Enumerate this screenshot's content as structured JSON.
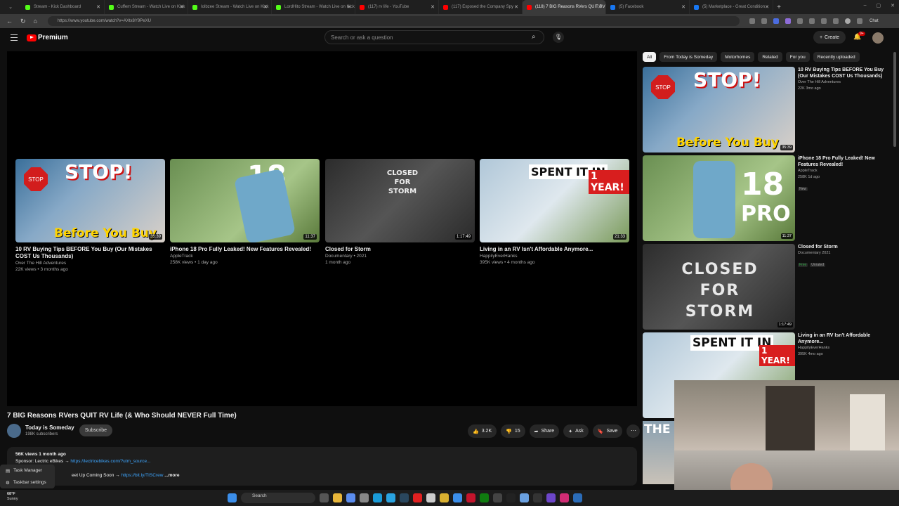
{
  "browser": {
    "tabs": [
      {
        "title": "Stream - Kick Dashboard",
        "color": "#53fc18"
      },
      {
        "title": "Cuffem Stream - Watch Live on Kick",
        "color": "#53fc18"
      },
      {
        "title": "Iolbzee Stream - Watch Live on Kick",
        "color": "#53fc18"
      },
      {
        "title": "LordHito Stream - Watch Live on Kick",
        "color": "#53fc18"
      },
      {
        "title": "(117) rv life - YouTube",
        "color": "#ff0000"
      },
      {
        "title": "(117) Exposed the Company Spy",
        "color": "#ff0000"
      },
      {
        "title": "(118) 7 BIG Reasons RVers QUIT RV",
        "color": "#ff0000",
        "active": true
      },
      {
        "title": "(5) Facebook",
        "color": "#1877f2"
      },
      {
        "title": "(5) Marketplace - Great Condition",
        "color": "#1877f2"
      }
    ],
    "url": "https://www.youtube.com/watch?v=AXtx8Y9PeXU",
    "chat_label": "Chat"
  },
  "header": {
    "logo_text": "Premium",
    "search_placeholder": "Search or ask a question",
    "create_label": "Create",
    "notif_badge": "9+"
  },
  "player": {
    "end_cards": [
      {
        "title": "10 RV Buying Tips BEFORE You Buy (Our Mistakes COST Us Thousands)",
        "channel": "Over The Hill Adventures",
        "stats": "22K views • 3 months ago",
        "duration": "35:39",
        "overlay_top": "STOP!",
        "overlay_bottom": "Before You Buy",
        "stop_text": "STOP"
      },
      {
        "title": "iPhone 18 Pro Fully Leaked! New Features Revealed!",
        "channel": "AppleTrack",
        "stats": "258K views • 1 day ago",
        "duration": "11:37",
        "overlay_top": "18"
      },
      {
        "title": "Closed for Storm",
        "channel": "Documentary • 2021",
        "stats": "1 month ago",
        "duration": "1:17:49",
        "overlay_top": "CLOSED FOR STORM"
      },
      {
        "title": "Living in an RV Isn't Affordable Anymore...",
        "channel": "HappilyEverHanks",
        "stats": "395K views • 4 months ago",
        "duration": "21:33",
        "overlay_top": "SPENT IT IN",
        "overlay_bottom": "1 YEAR!"
      }
    ]
  },
  "video": {
    "title": "7 BIG Reasons RVers QUIT RV Life (& Who Should NEVER Full Time)",
    "channel": "Today is Someday",
    "subscribers": "198K subscribers",
    "subscribe_label": "Subscribe",
    "likes": "3.2K",
    "dislikes": "15",
    "share_label": "Share",
    "ask_label": "Ask",
    "save_label": "Save",
    "description": {
      "stats": "56K views  1 month ago",
      "line1_prefix": "Sponsor: Lectric eBikes → ",
      "line1_link": "https://lectricebikes.com/?utm_source...",
      "line2_prefix": "eet Up Coming Soon → ",
      "line2_link": "https://bit.ly/TISCrew",
      "more_label": "...more"
    }
  },
  "context_menu": {
    "items": [
      "Task Manager",
      "Taskbar settings"
    ]
  },
  "sidebar": {
    "chips": [
      "All",
      "From Today is Someday",
      "Motorhomes",
      "Related",
      "For you",
      "Recently uploaded"
    ],
    "recommendations": [
      {
        "title": "10 RV Buying Tips BEFORE You Buy (Our Mistakes COST Us Thousands)",
        "channel": "Over The Hill Adventures",
        "stats": "22K  3mo ago",
        "duration": "35:39"
      },
      {
        "title": "iPhone 18 Pro Fully Leaked! New Features Revealed!",
        "channel": "AppleTrack",
        "stats": "258K  1d ago",
        "duration": "11:37",
        "tags": [
          "New"
        ],
        "thumb_text": "18",
        "thumb_text2": "PRO"
      },
      {
        "title": "Closed for Storm",
        "channel": "Documentary 2021",
        "stats": "",
        "duration": "1:17:49",
        "tags": [
          "Free",
          "Unrated"
        ],
        "thumb_text": "CLOSED FOR STORM"
      },
      {
        "title": "Living in an RV Isn't Affordable Anymore...",
        "channel": "HappilyEverHanks",
        "stats": "395K  4mo ago",
        "duration": "",
        "thumb_text": "SPENT IT IN",
        "thumb_text2": "1 YEAR!"
      }
    ],
    "partial_thumb_text": "THE"
  },
  "taskbar": {
    "temp": "68°F",
    "condition": "Sunny",
    "search_label": "Search"
  },
  "colors": {
    "accent_red": "#ff0000",
    "link_blue": "#3ea6ff",
    "bg": "#0f0f0f"
  }
}
